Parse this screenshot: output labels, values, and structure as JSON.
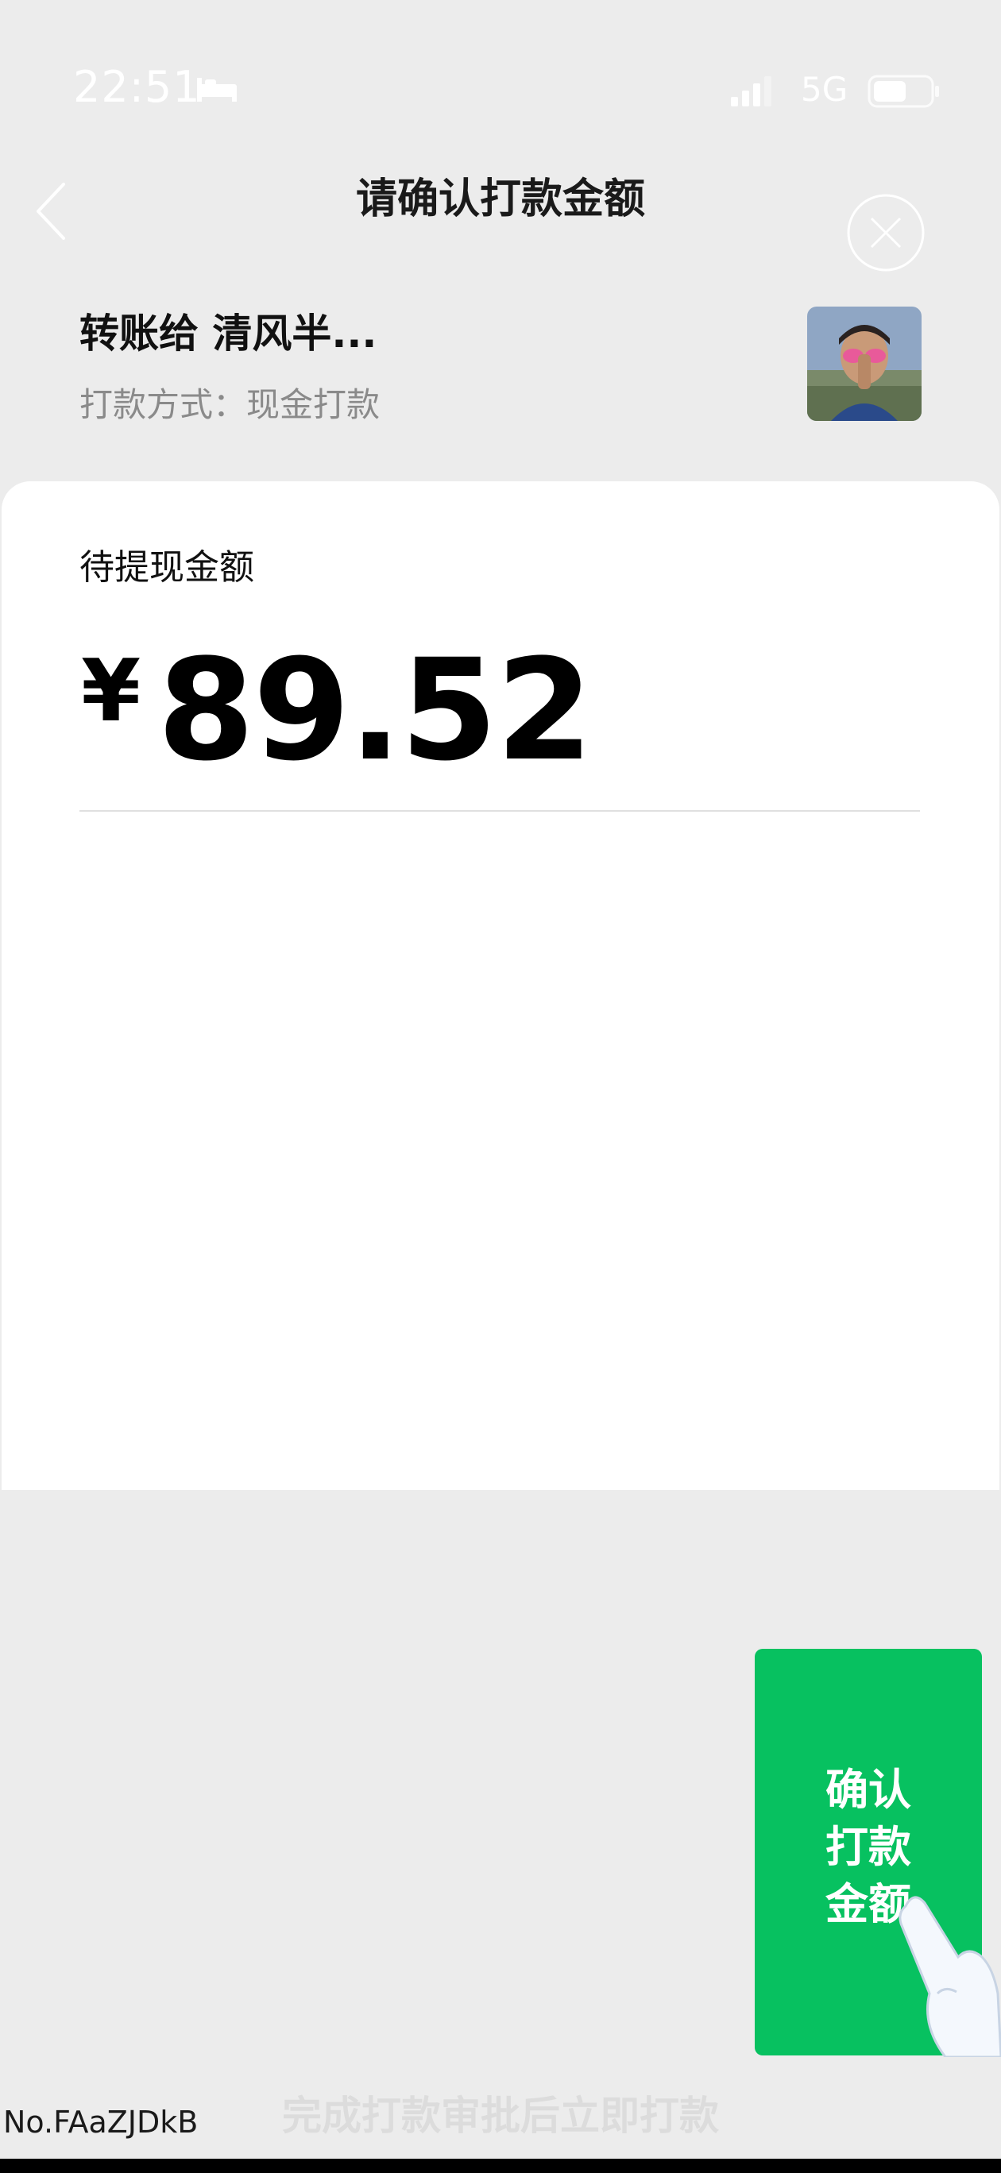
{
  "status_bar": {
    "time": "22:51",
    "network": "5G"
  },
  "header": {
    "title": "请确认打款金额"
  },
  "recipient": {
    "text": "转账给 清风半...",
    "method": "打款方式：现金打款"
  },
  "card": {
    "label": "待提现金额",
    "currency": "¥",
    "amount": "89.52"
  },
  "confirm_button": {
    "line1": "确认",
    "line2": "打款",
    "line3": "金额"
  },
  "footer": {
    "note": "完成打款审批后立即打款",
    "order_no": "No.FAaZJDkB"
  },
  "colors": {
    "background": "#ececec",
    "accent_green": "#07c160",
    "card": "#ffffff"
  }
}
